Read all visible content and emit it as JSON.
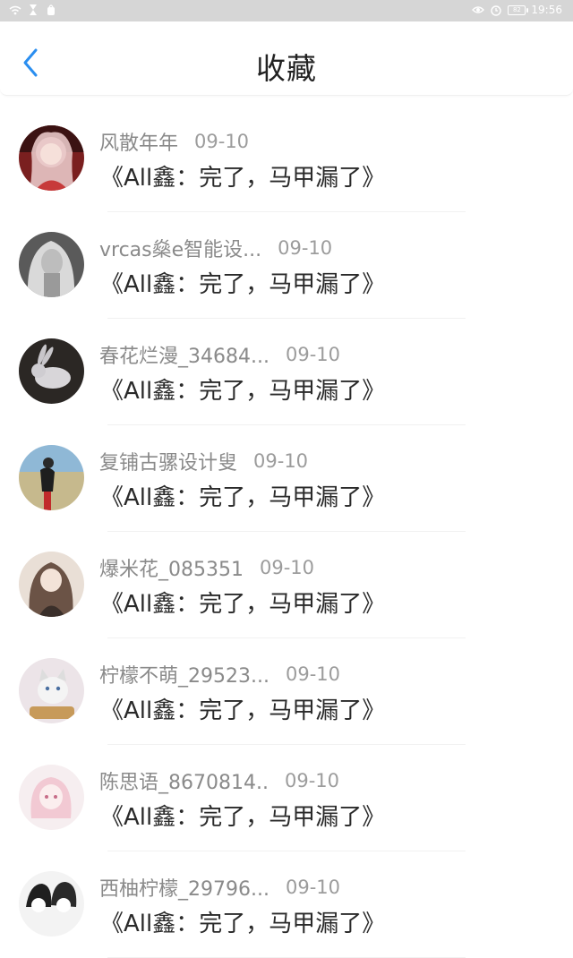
{
  "status_bar": {
    "time": "19:56",
    "battery": "82",
    "left_icons": [
      "wifi-icon",
      "hourglass-icon",
      "bag-icon"
    ],
    "right_icons": [
      "eye-icon",
      "alarm-icon",
      "battery-icon"
    ]
  },
  "header": {
    "title": "收藏",
    "back_icon": "chevron-left-icon",
    "accent_color": "#2a8ef0"
  },
  "favorites": [
    {
      "username": "风散年年",
      "date": "09-10",
      "work": "《All鑫：完了，马甲漏了》",
      "avatar": "girl-red-avatar"
    },
    {
      "username": "vrcas燊e智能设...",
      "date": "09-10",
      "work": "《All鑫：完了，马甲漏了》",
      "avatar": "blonde-bw-avatar"
    },
    {
      "username": "春花烂漫_34684...",
      "date": "09-10",
      "work": "《All鑫：完了，马甲漏了》",
      "avatar": "rabbit-avatar"
    },
    {
      "username": "复铺古骡设计叟",
      "date": "09-10",
      "work": "《All鑫：完了，马甲漏了》",
      "avatar": "beach-girl-avatar"
    },
    {
      "username": "爆米花_085351",
      "date": "09-10",
      "work": "《All鑫：完了，马甲漏了》",
      "avatar": "anime-girl-avatar"
    },
    {
      "username": "柠檬不萌_29523...",
      "date": "09-10",
      "work": "《All鑫：完了，马甲漏了》",
      "avatar": "cat-avatar"
    },
    {
      "username": "陈思语_8670814..",
      "date": "09-10",
      "work": "《All鑫：完了，马甲漏了》",
      "avatar": "pink-anime-avatar"
    },
    {
      "username": "西柚柠檬_29796...",
      "date": "09-10",
      "work": "《All鑫：完了，马甲漏了》",
      "avatar": "couple-sketch-avatar"
    }
  ]
}
